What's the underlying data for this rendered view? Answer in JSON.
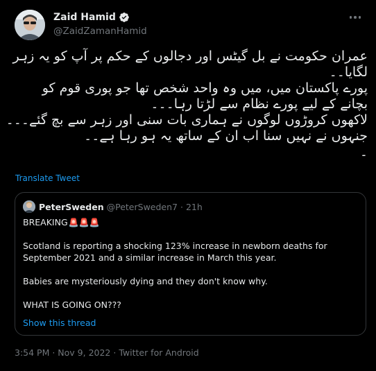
{
  "author": {
    "display_name": "Zaid Hamid",
    "handle": "@ZaidZamanHamid",
    "verified": true
  },
  "tweet_lines": [
    "عمران حکومت نے بل گیٹس اور دجالوں کے حکم پر آپ کو یہ زہر",
    "لگایا۔۔",
    "پورے پاکستان میں، میں وہ واحد شخص تھا جو پوری قوم کو",
    "بچانے کے لیے پورے نظام سے لڑتا رہا۔۔۔",
    "لاکھوں کروڑوں لوگوں نے ہماری بات سنی اور زہر سے بچ گئے۔۔۔",
    "جنہوں نے نہیں سنا اب ان کے ساتھ یہ ہو رہا ہے۔۔",
    "۔"
  ],
  "translate_label": "Translate Tweet",
  "quoted": {
    "display_name": "PeterSweden",
    "handle": "@PeterSweden7",
    "time": "· 21h",
    "line1": "BREAKING",
    "siren_emoji": "🚨🚨🚨",
    "paragraph2_line1": "Scotland is reporting a shocking 123% increase in newborn deaths for",
    "paragraph2_line2": "September 2021 and a similar increase in March this year.",
    "paragraph3": "Babies are mysteriously dying and they don't know why.",
    "paragraph4": "WHAT IS GOING ON???",
    "show_thread": "Show this thread"
  },
  "meta": {
    "time": "3:54 PM",
    "sep1": " · ",
    "date": "Nov 9, 2022",
    "sep2": " · ",
    "source": "Twitter for Android"
  },
  "colors": {
    "background": "#000000",
    "text": "#e7e9ea",
    "muted": "#71767b",
    "link": "#1d9bf0",
    "border": "#333639",
    "verified": "#1d9bf0"
  },
  "icons": {
    "verified": "verified-badge-icon",
    "more": "more-options-icon",
    "siren": "siren-emoji"
  }
}
